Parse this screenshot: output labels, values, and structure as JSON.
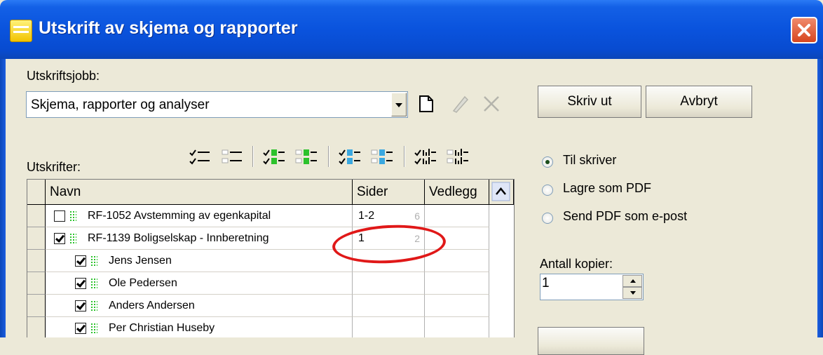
{
  "window": {
    "title": "Utskrift av skjema og rapporter"
  },
  "job": {
    "label": "Utskriftsjobb:",
    "selected": "Skjema, rapporter og analyser"
  },
  "buttons": {
    "print": "Skriv ut",
    "cancel": "Avbryt"
  },
  "printouts": {
    "label": "Utskrifter:",
    "columns": [
      "Navn",
      "Sider",
      "Vedlegg"
    ],
    "rows": [
      {
        "name": "RF-1052 Avstemming av egenkapital",
        "pages": "1-2",
        "attachments": "6",
        "checked": false,
        "level": 0
      },
      {
        "name": "RF-1139 Boligselskap - Innberetning",
        "pages": "1",
        "attachments": "2",
        "checked": true,
        "level": 0
      },
      {
        "name": "Jens Jensen",
        "pages": "",
        "attachments": "",
        "checked": true,
        "level": 1
      },
      {
        "name": "Ole Pedersen",
        "pages": "",
        "attachments": "",
        "checked": true,
        "level": 1
      },
      {
        "name": "Anders Andersen",
        "pages": "",
        "attachments": "",
        "checked": true,
        "level": 1
      },
      {
        "name": "Per Christian Huseby",
        "pages": "",
        "attachments": "",
        "checked": true,
        "level": 1
      }
    ]
  },
  "output": {
    "options": [
      "Til skriver",
      "Lagre som PDF",
      "Send PDF som e-post"
    ],
    "selected_index": 0
  },
  "copies": {
    "label": "Antall kopier:",
    "value": "1"
  },
  "colors": {
    "titlebar": "#0a53dd",
    "close": "#d7461f",
    "face": "#ece9d8",
    "annotation": "#e01818"
  }
}
